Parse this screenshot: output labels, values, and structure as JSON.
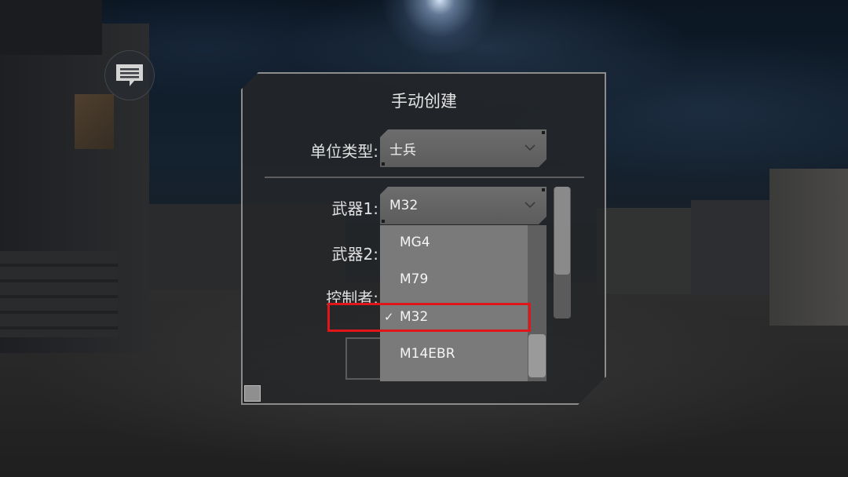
{
  "dialog": {
    "title": "手动创建",
    "unit_type": {
      "label": "单位类型:",
      "value": "士兵"
    },
    "weapon1": {
      "label": "武器1:",
      "value": "M32"
    },
    "weapon2": {
      "label": "武器2:"
    },
    "controller": {
      "label": "控制者:"
    }
  },
  "weapon_list": {
    "items": [
      {
        "label": "MG4",
        "selected": false
      },
      {
        "label": "M79",
        "selected": false
      },
      {
        "label": "M32",
        "selected": true
      },
      {
        "label": "M14EBR",
        "selected": false
      }
    ],
    "check_mark": "✓"
  },
  "icons": {
    "chat": "chat-bubble-icon",
    "dropdown": "chevron-down-icon"
  },
  "colors": {
    "highlight": "#e0161b"
  }
}
